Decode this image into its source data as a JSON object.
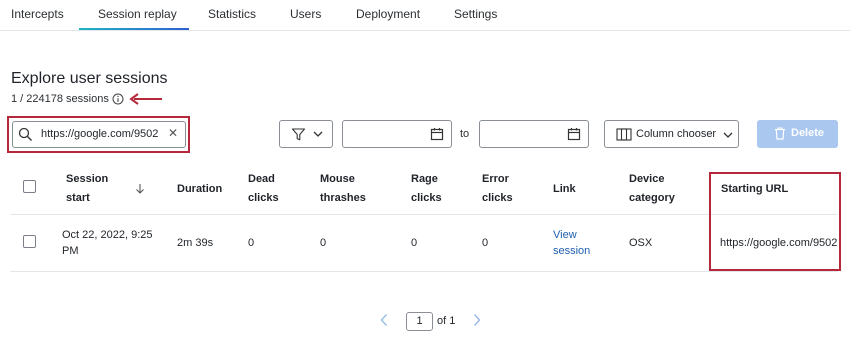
{
  "tabs": [
    {
      "label": "Intercepts"
    },
    {
      "label": "Session replay"
    },
    {
      "label": "Statistics"
    },
    {
      "label": "Users"
    },
    {
      "label": "Deployment"
    },
    {
      "label": "Settings"
    }
  ],
  "active_tab": "Session replay",
  "page": {
    "title": "Explore user sessions",
    "session_count": "1 / 224178 sessions"
  },
  "toolbar": {
    "search_value": "https://google.com/9502",
    "date_to_label": "to",
    "column_chooser_label": "Column chooser",
    "delete_label": "Delete"
  },
  "table": {
    "headers": {
      "session_start": [
        "Session",
        "start"
      ],
      "duration": "Duration",
      "dead_clicks": [
        "Dead",
        "clicks"
      ],
      "mouse_thrashes": [
        "Mouse",
        "thrashes"
      ],
      "rage_clicks": [
        "Rage",
        "clicks"
      ],
      "error_clicks": [
        "Error",
        "clicks"
      ],
      "link": "Link",
      "device_category": [
        "Device",
        "category"
      ],
      "starting_url": "Starting URL"
    },
    "rows": [
      {
        "session_start": [
          "Oct 22, 2022, 9:25",
          "PM"
        ],
        "duration": "2m 39s",
        "dead_clicks": "0",
        "mouse_thrashes": "0",
        "rage_clicks": "0",
        "error_clicks": "0",
        "link": [
          "View",
          "session"
        ],
        "device_category": "OSX",
        "starting_url": "https://google.com/9502"
      }
    ]
  },
  "pagination": {
    "current_page": "1",
    "of_label": "of 1"
  },
  "colors": {
    "accent": "#2f5fd0",
    "annotation": "#b5283a",
    "delete_disabled": "#a9c7ef",
    "link": "#1f5fae"
  }
}
